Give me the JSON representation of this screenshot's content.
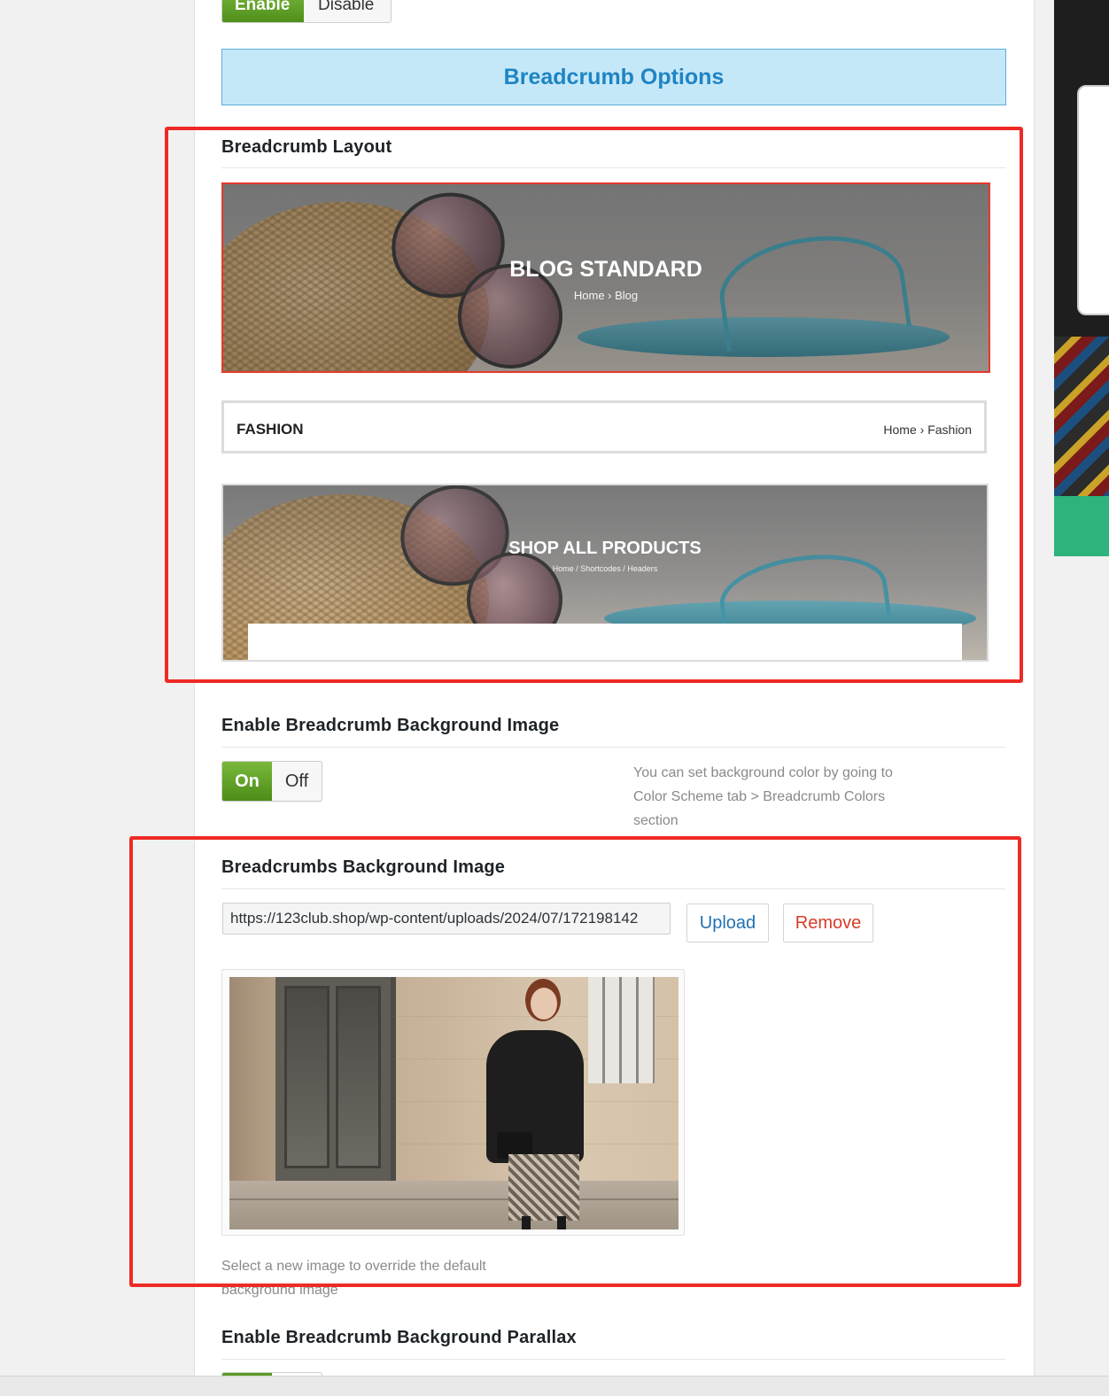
{
  "top_toggle": {
    "enable_label": "Enable",
    "disable_label": "Disable"
  },
  "section_banner": {
    "title": "Breadcrumb Options"
  },
  "breadcrumb_layout": {
    "title": "Breadcrumb Layout",
    "options": [
      {
        "title": "BLOG STANDARD",
        "crumb": "Home › Blog",
        "selected": true
      },
      {
        "title": "FASHION",
        "crumb": "Home › Fashion",
        "selected": false
      },
      {
        "title": "SHOP ALL PRODUCTS",
        "crumb": "Home  /  Shortcodes  /  Headers",
        "selected": false
      }
    ]
  },
  "bg_image_toggle": {
    "title": "Enable Breadcrumb Background Image",
    "on_label": "On",
    "off_label": "Off",
    "value": "On",
    "description": "You can set background color by going to Color Scheme tab > Breadcrumb Colors section"
  },
  "bg_image": {
    "title": "Breadcrumbs Background Image",
    "url_value": "https://123club.shop/wp-content/uploads/2024/07/172198142",
    "upload_label": "Upload",
    "remove_label": "Remove",
    "help_text": "Select a new image to override the default background image"
  },
  "parallax": {
    "title": "Enable Breadcrumb Background Parallax"
  },
  "colors": {
    "accent_green": "#5a9a24",
    "banner_blue": "#1e84c4",
    "highlight_red": "#ee2a24",
    "link_blue": "#2271b1",
    "remove_red": "#d63c28"
  }
}
